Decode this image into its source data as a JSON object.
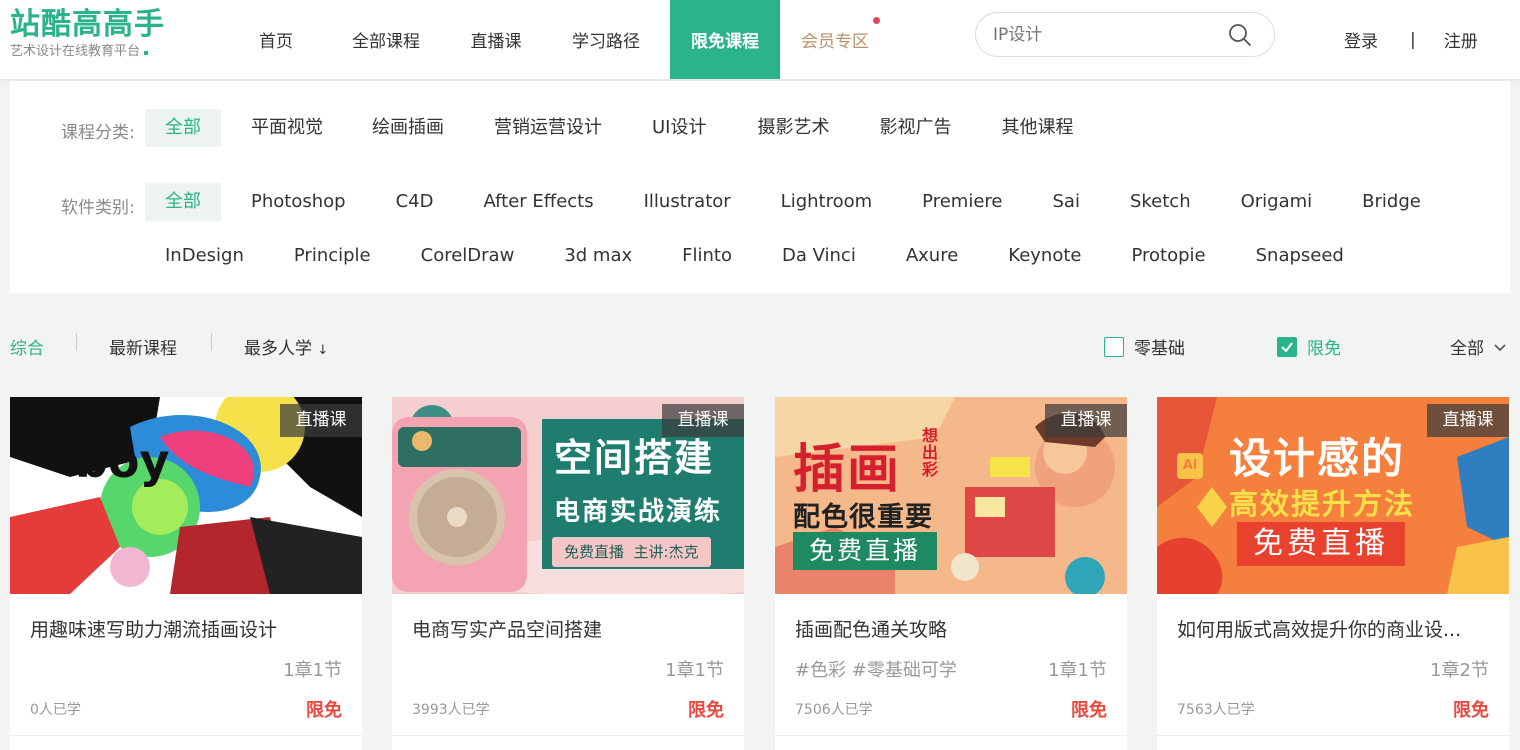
{
  "logo": {
    "title": "站酷高高手",
    "subtitle": "艺术设计在线教育平台"
  },
  "nav": [
    "首页",
    "全部课程",
    "直播课",
    "学习路径",
    "限免课程",
    "会员专区"
  ],
  "search": {
    "placeholder": "IP设计"
  },
  "auth": {
    "login": "登录",
    "separator": "|",
    "register": "注册"
  },
  "filter": {
    "category_label": "课程分类:",
    "categories": [
      "全部",
      "平面视觉",
      "绘画插画",
      "营销运营设计",
      "UI设计",
      "摄影艺术",
      "影视广告",
      "其他课程"
    ],
    "software_label": "软件类别:",
    "software_row1": [
      "全部",
      "Photoshop",
      "C4D",
      "After Effects",
      "Illustrator",
      "Lightroom",
      "Premiere",
      "Sai",
      "Sketch",
      "Origami",
      "Bridge"
    ],
    "software_row2": [
      "InDesign",
      "Principle",
      "CorelDraw",
      "3d max",
      "Flinto",
      "Da Vinci",
      "Axure",
      "Keynote",
      "Protopie",
      "Snapseed"
    ]
  },
  "sort": {
    "items": [
      "综合",
      "最新课程",
      "最多人学"
    ],
    "sort_arrow": "↓",
    "zero_basis": "零基础",
    "free": "限免",
    "all": "全部"
  },
  "colors": {
    "accent": "#2bb38b",
    "price": "#e84a3f",
    "vip": "#b8926b"
  },
  "cards": [
    {
      "tag": "直播课",
      "title": "用趣味速写助力潮流插画设计",
      "tags": "",
      "chapters": "1章1节",
      "learners": "0人已学",
      "price": "限免"
    },
    {
      "tag": "直播课",
      "title": "电商写实产品空间搭建",
      "tags": "",
      "chapters": "1章1节",
      "learners": "3993人已学",
      "price": "限免",
      "banner": {
        "title": "空间搭建",
        "subtitle": "电商实战演练",
        "note": "免费直播  主讲:杰克"
      }
    },
    {
      "tag": "直播课",
      "title": "插画配色通关攻略",
      "tags": "#色彩 #零基础可学",
      "chapters": "1章1节",
      "learners": "7506人已学",
      "price": "限免",
      "banner": {
        "title": "插画",
        "side": "想出彩",
        "subtitle": "配色很重要",
        "note": "免费直播"
      }
    },
    {
      "tag": "直播课",
      "title": "如何用版式高效提升你的商业设...",
      "tags": "",
      "chapters": "1章2节",
      "learners": "7563人已学",
      "price": "限免",
      "banner": {
        "title": "设计感的",
        "subtitle": "高效提升方法",
        "note": "免费直播",
        "badge": "Ai"
      }
    }
  ]
}
